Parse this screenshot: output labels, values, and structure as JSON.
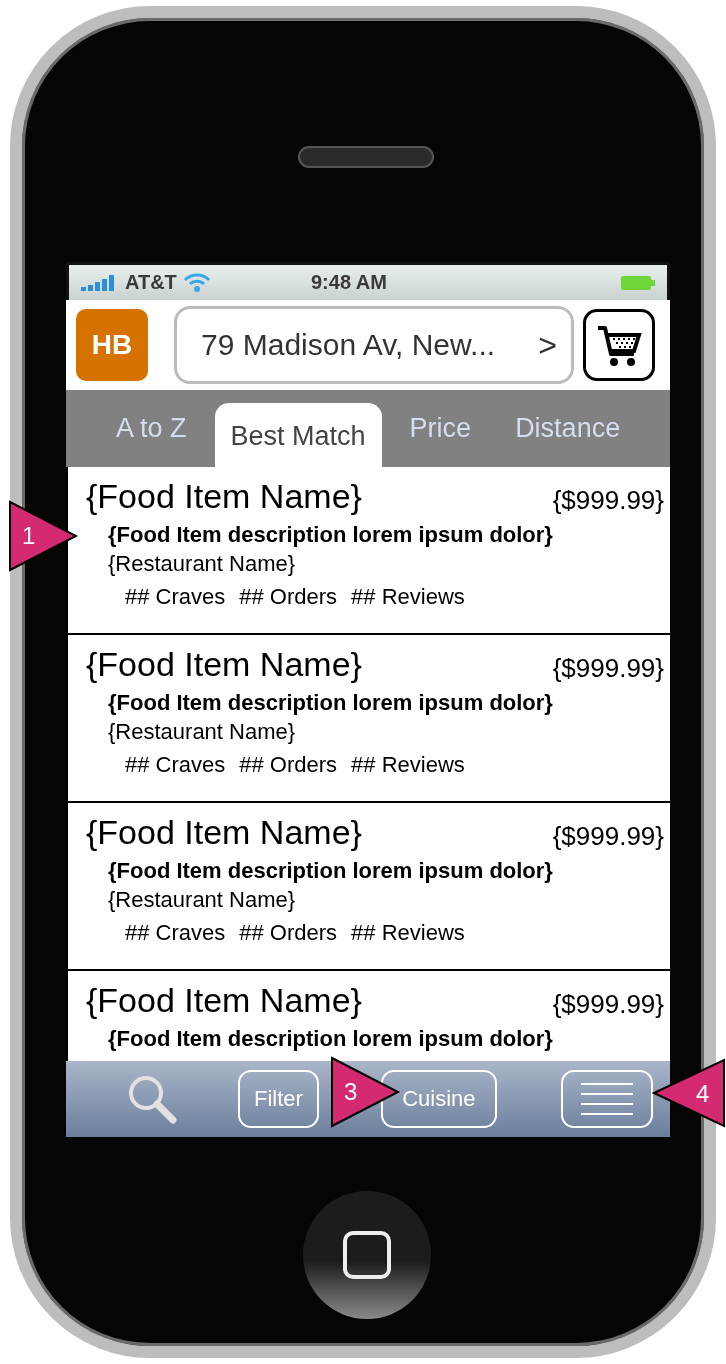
{
  "status_bar": {
    "carrier": "AT&T",
    "time": "9:48 AM"
  },
  "header": {
    "logo": "HB",
    "address": "79 Madison Av, New...",
    "address_arrow": ">"
  },
  "tabs": [
    {
      "label": "A to Z",
      "selected": false
    },
    {
      "label": "Best Match",
      "selected": true
    },
    {
      "label": "Price",
      "selected": false
    },
    {
      "label": "Distance",
      "selected": false
    }
  ],
  "items": [
    {
      "name": "{Food Item Name}",
      "price": "{$999.99}",
      "description": "{Food Item description lorem ipsum dolor}",
      "restaurant": "{Restaurant Name}",
      "stats": [
        "## Craves",
        "## Orders",
        "## Reviews"
      ]
    },
    {
      "name": "{Food Item Name}",
      "price": "{$999.99}",
      "description": "{Food Item description lorem ipsum dolor}",
      "restaurant": "{Restaurant Name}",
      "stats": [
        "## Craves",
        "## Orders",
        "## Reviews"
      ]
    },
    {
      "name": "{Food Item Name}",
      "price": "{$999.99}",
      "description": "{Food Item description lorem ipsum dolor}",
      "restaurant": "{Restaurant Name}",
      "stats": [
        "## Craves",
        "## Orders",
        "## Reviews"
      ]
    },
    {
      "name": "{Food Item Name}",
      "price": "{$999.99}",
      "description": "{Food Item description lorem ipsum dolor}"
    }
  ],
  "toolbar": [
    {
      "kind": "search"
    },
    {
      "kind": "text",
      "label": "Filter"
    },
    {
      "kind": "text",
      "label": "Cuisine"
    },
    {
      "kind": "menu"
    }
  ],
  "callouts": [
    {
      "label": "1",
      "kind": "right"
    },
    {
      "label": "3",
      "kind": "right"
    },
    {
      "label": "4",
      "kind": "left"
    }
  ]
}
